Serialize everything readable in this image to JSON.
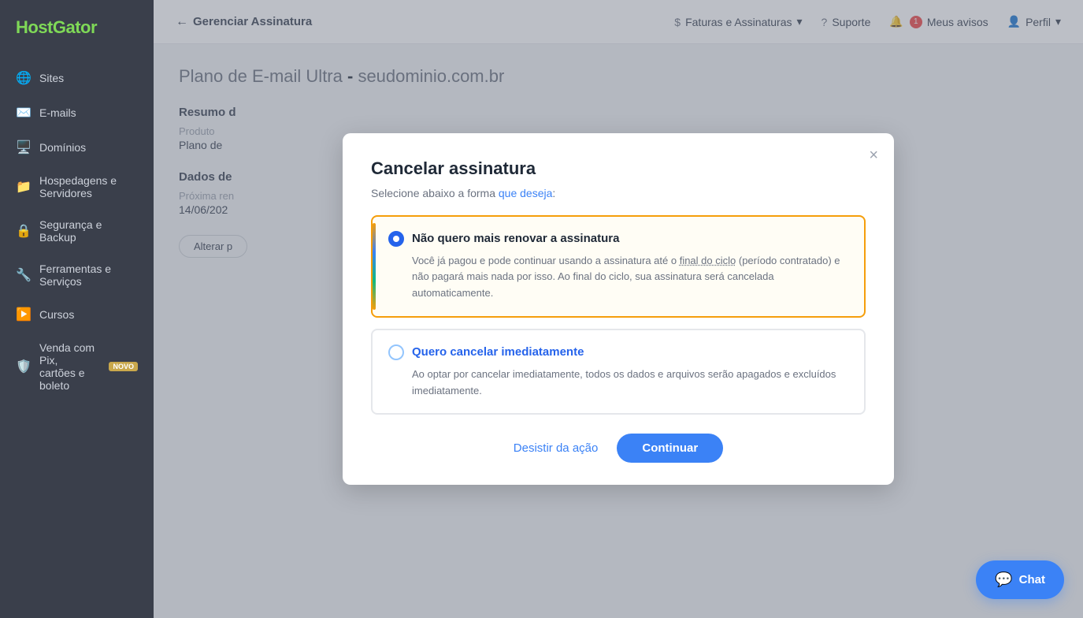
{
  "brand": {
    "name": "HostGator"
  },
  "sidebar": {
    "items": [
      {
        "id": "sites",
        "label": "Sites",
        "icon": "🌐"
      },
      {
        "id": "emails",
        "label": "E-mails",
        "icon": "✉️"
      },
      {
        "id": "dominios",
        "label": "Domínios",
        "icon": "🖥️"
      },
      {
        "id": "hospedagens",
        "label": "Hospedagens e Servidores",
        "icon": "📁"
      },
      {
        "id": "seguranca",
        "label": "Segurança e Backup",
        "icon": "🔒"
      },
      {
        "id": "ferramentas",
        "label": "Ferramentas e Serviços",
        "icon": "🔧"
      },
      {
        "id": "cursos",
        "label": "Cursos",
        "icon": "▶️"
      },
      {
        "id": "venda",
        "label": "Venda com Pix, cartões e boleto",
        "icon": "🛡️",
        "badge": "NOVO"
      }
    ]
  },
  "topnav": {
    "back_label": "Gerenciar Assinatura",
    "faturas_label": "Faturas e Assinaturas",
    "suporte_label": "Suporte",
    "avisos_label": "Meus avisos",
    "avisos_count": "1",
    "perfil_label": "Perfil"
  },
  "page": {
    "title": "Plano de E-mail Ultra",
    "domain": "seudominio.com.br",
    "resumo_label": "Resumo d",
    "produto_label": "Produto",
    "produto_value": "Plano de",
    "dados_label": "Dados de",
    "proxima_label": "Próxima ren",
    "proxima_value": "14/06/202",
    "alterar_label": "Alterar p"
  },
  "modal": {
    "title": "Cancelar assinatura",
    "subtitle": "Selecione abaixo a forma ",
    "subtitle_link": "que deseja",
    "subtitle_end": ":",
    "option1": {
      "label": "Não quero mais renovar a assinatura",
      "description": "Você já pagou e pode continuar usando a assinatura até o ",
      "desc_link": "final do ciclo",
      "desc_paren": " (período contratado)",
      "desc_end": " e não pagará mais nada por isso. Ao final do ciclo, sua assinatura será cancelada automaticamente.",
      "selected": true
    },
    "option2": {
      "label": "Quero cancelar imediatamente",
      "description": "Ao optar por cancelar imediatamente, todos os dados e arquivos serão apagados e excluídos imediatamente.",
      "selected": false
    },
    "btn_desistir": "Desistir da ação",
    "btn_continuar": "Continuar",
    "close_label": "×"
  },
  "chat": {
    "label": "Chat"
  }
}
